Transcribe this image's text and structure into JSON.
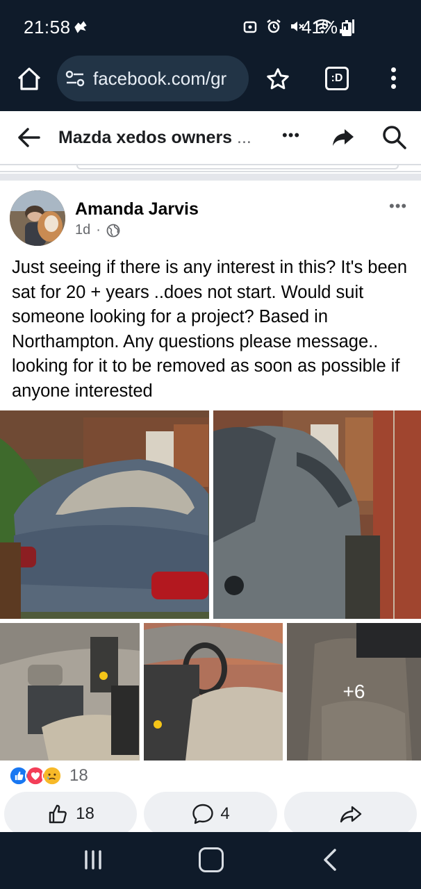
{
  "status_bar": {
    "time": "21:58",
    "battery_text": "41%",
    "battery_level": 0.41
  },
  "browser": {
    "url": "facebook.com/gr",
    "tabs_label": ":D"
  },
  "header": {
    "group_title": "Mazda xedos owners",
    "ellipsis": "..."
  },
  "post": {
    "author": "Amanda Jarvis",
    "age": "1d",
    "meta_sep": "·",
    "text": "Just seeing if there is any interest in this? It's been sat for 20 + years ..does not start. Would suit someone looking for a project? Based in Northampton. Any questions please message.. looking for it to be removed as soon as possible if anyone interested",
    "more_photos": "+6"
  },
  "reactions": {
    "count": "18"
  },
  "actions": {
    "like_count": "18",
    "comment_count": "4"
  },
  "colors": {
    "dark_bar": "#0f1b2a",
    "fb_like_blue": "#1877f2",
    "love_red": "#f33e58",
    "sad_yellow": "#f7b928"
  }
}
